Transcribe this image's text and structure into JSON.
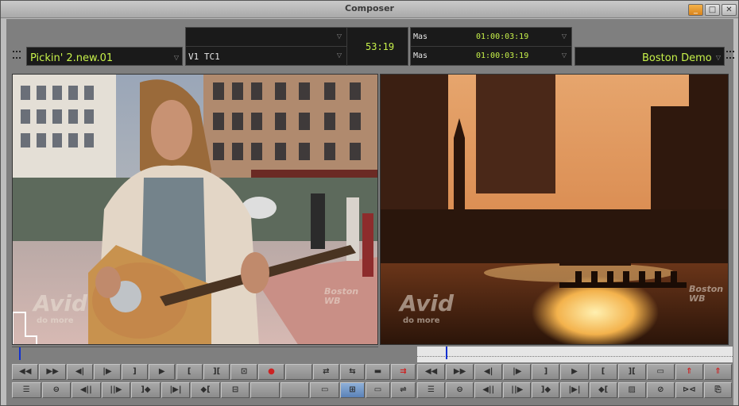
{
  "window": {
    "title": "Composer",
    "min": "_",
    "max": "□",
    "close": "✕"
  },
  "source": {
    "clip_name": "Pickin' 2.new.01",
    "arrow": "▽"
  },
  "center": {
    "track_label": "V1 TC1",
    "duration": "53:19",
    "arrow": "▽"
  },
  "timecodes": [
    {
      "label": "Mas",
      "value": "01:00:03:19",
      "arrow": "▽"
    },
    {
      "label": "Mas",
      "value": "01:00:03:19",
      "arrow": "▽"
    }
  ],
  "record": {
    "sequence_name": "Boston Demo",
    "arrow": "▽"
  },
  "viewers": {
    "left": {
      "watermark_main": "Avid",
      "watermark_sub": "do more",
      "channel_logo": "Boston WB"
    },
    "right": {
      "watermark_main": "Avid",
      "watermark_sub": "do more",
      "channel_logo": "Boston WB"
    }
  },
  "source_position": 0.02,
  "record_position": 0.09,
  "buttons": {
    "left_row1": [
      "◀◀",
      "▶▶",
      "◀|",
      "|▶",
      "]",
      "▶",
      "[",
      "][",
      "⊡",
      "●",
      "",
      "⇄"
    ],
    "left_row2": [
      "☰",
      "⊖",
      "◀||",
      "||▶",
      "]◆",
      "|▶|",
      "◆[",
      "⊟",
      "",
      "",
      "▭"
    ],
    "center": [
      "⇆",
      "▬",
      "⇉",
      "⊞",
      "▭",
      "⇌"
    ],
    "right_row1": [
      "◀◀",
      "▶▶",
      "◀|",
      "|▶",
      "]",
      "▶",
      "[",
      "][",
      "▭",
      "⇑",
      "⇑"
    ],
    "right_row2": [
      "☰",
      "⊖",
      "◀||",
      "||▶",
      "]◆",
      "|▶|",
      "◆[",
      "▨",
      "⊘",
      "⊳⊲",
      "⎘"
    ]
  },
  "icons": [
    "source-menu-icon",
    "record-menu-icon"
  ],
  "colors": {
    "accent_green": "#c7f14a",
    "blue_playhead": "#1030d0",
    "record_red": "#cc2222"
  }
}
